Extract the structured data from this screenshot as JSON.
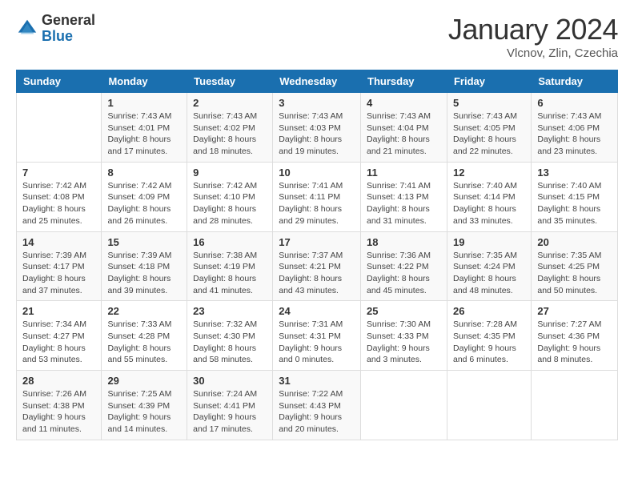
{
  "logo": {
    "general": "General",
    "blue": "Blue"
  },
  "title": "January 2024",
  "location": "Vlcnov, Zlin, Czechia",
  "days_header": [
    "Sunday",
    "Monday",
    "Tuesday",
    "Wednesday",
    "Thursday",
    "Friday",
    "Saturday"
  ],
  "weeks": [
    [
      {
        "num": "",
        "sunrise": "",
        "sunset": "",
        "daylight": ""
      },
      {
        "num": "1",
        "sunrise": "Sunrise: 7:43 AM",
        "sunset": "Sunset: 4:01 PM",
        "daylight": "Daylight: 8 hours and 17 minutes."
      },
      {
        "num": "2",
        "sunrise": "Sunrise: 7:43 AM",
        "sunset": "Sunset: 4:02 PM",
        "daylight": "Daylight: 8 hours and 18 minutes."
      },
      {
        "num": "3",
        "sunrise": "Sunrise: 7:43 AM",
        "sunset": "Sunset: 4:03 PM",
        "daylight": "Daylight: 8 hours and 19 minutes."
      },
      {
        "num": "4",
        "sunrise": "Sunrise: 7:43 AM",
        "sunset": "Sunset: 4:04 PM",
        "daylight": "Daylight: 8 hours and 21 minutes."
      },
      {
        "num": "5",
        "sunrise": "Sunrise: 7:43 AM",
        "sunset": "Sunset: 4:05 PM",
        "daylight": "Daylight: 8 hours and 22 minutes."
      },
      {
        "num": "6",
        "sunrise": "Sunrise: 7:43 AM",
        "sunset": "Sunset: 4:06 PM",
        "daylight": "Daylight: 8 hours and 23 minutes."
      }
    ],
    [
      {
        "num": "7",
        "sunrise": "Sunrise: 7:42 AM",
        "sunset": "Sunset: 4:08 PM",
        "daylight": "Daylight: 8 hours and 25 minutes."
      },
      {
        "num": "8",
        "sunrise": "Sunrise: 7:42 AM",
        "sunset": "Sunset: 4:09 PM",
        "daylight": "Daylight: 8 hours and 26 minutes."
      },
      {
        "num": "9",
        "sunrise": "Sunrise: 7:42 AM",
        "sunset": "Sunset: 4:10 PM",
        "daylight": "Daylight: 8 hours and 28 minutes."
      },
      {
        "num": "10",
        "sunrise": "Sunrise: 7:41 AM",
        "sunset": "Sunset: 4:11 PM",
        "daylight": "Daylight: 8 hours and 29 minutes."
      },
      {
        "num": "11",
        "sunrise": "Sunrise: 7:41 AM",
        "sunset": "Sunset: 4:13 PM",
        "daylight": "Daylight: 8 hours and 31 minutes."
      },
      {
        "num": "12",
        "sunrise": "Sunrise: 7:40 AM",
        "sunset": "Sunset: 4:14 PM",
        "daylight": "Daylight: 8 hours and 33 minutes."
      },
      {
        "num": "13",
        "sunrise": "Sunrise: 7:40 AM",
        "sunset": "Sunset: 4:15 PM",
        "daylight": "Daylight: 8 hours and 35 minutes."
      }
    ],
    [
      {
        "num": "14",
        "sunrise": "Sunrise: 7:39 AM",
        "sunset": "Sunset: 4:17 PM",
        "daylight": "Daylight: 8 hours and 37 minutes."
      },
      {
        "num": "15",
        "sunrise": "Sunrise: 7:39 AM",
        "sunset": "Sunset: 4:18 PM",
        "daylight": "Daylight: 8 hours and 39 minutes."
      },
      {
        "num": "16",
        "sunrise": "Sunrise: 7:38 AM",
        "sunset": "Sunset: 4:19 PM",
        "daylight": "Daylight: 8 hours and 41 minutes."
      },
      {
        "num": "17",
        "sunrise": "Sunrise: 7:37 AM",
        "sunset": "Sunset: 4:21 PM",
        "daylight": "Daylight: 8 hours and 43 minutes."
      },
      {
        "num": "18",
        "sunrise": "Sunrise: 7:36 AM",
        "sunset": "Sunset: 4:22 PM",
        "daylight": "Daylight: 8 hours and 45 minutes."
      },
      {
        "num": "19",
        "sunrise": "Sunrise: 7:35 AM",
        "sunset": "Sunset: 4:24 PM",
        "daylight": "Daylight: 8 hours and 48 minutes."
      },
      {
        "num": "20",
        "sunrise": "Sunrise: 7:35 AM",
        "sunset": "Sunset: 4:25 PM",
        "daylight": "Daylight: 8 hours and 50 minutes."
      }
    ],
    [
      {
        "num": "21",
        "sunrise": "Sunrise: 7:34 AM",
        "sunset": "Sunset: 4:27 PM",
        "daylight": "Daylight: 8 hours and 53 minutes."
      },
      {
        "num": "22",
        "sunrise": "Sunrise: 7:33 AM",
        "sunset": "Sunset: 4:28 PM",
        "daylight": "Daylight: 8 hours and 55 minutes."
      },
      {
        "num": "23",
        "sunrise": "Sunrise: 7:32 AM",
        "sunset": "Sunset: 4:30 PM",
        "daylight": "Daylight: 8 hours and 58 minutes."
      },
      {
        "num": "24",
        "sunrise": "Sunrise: 7:31 AM",
        "sunset": "Sunset: 4:31 PM",
        "daylight": "Daylight: 9 hours and 0 minutes."
      },
      {
        "num": "25",
        "sunrise": "Sunrise: 7:30 AM",
        "sunset": "Sunset: 4:33 PM",
        "daylight": "Daylight: 9 hours and 3 minutes."
      },
      {
        "num": "26",
        "sunrise": "Sunrise: 7:28 AM",
        "sunset": "Sunset: 4:35 PM",
        "daylight": "Daylight: 9 hours and 6 minutes."
      },
      {
        "num": "27",
        "sunrise": "Sunrise: 7:27 AM",
        "sunset": "Sunset: 4:36 PM",
        "daylight": "Daylight: 9 hours and 8 minutes."
      }
    ],
    [
      {
        "num": "28",
        "sunrise": "Sunrise: 7:26 AM",
        "sunset": "Sunset: 4:38 PM",
        "daylight": "Daylight: 9 hours and 11 minutes."
      },
      {
        "num": "29",
        "sunrise": "Sunrise: 7:25 AM",
        "sunset": "Sunset: 4:39 PM",
        "daylight": "Daylight: 9 hours and 14 minutes."
      },
      {
        "num": "30",
        "sunrise": "Sunrise: 7:24 AM",
        "sunset": "Sunset: 4:41 PM",
        "daylight": "Daylight: 9 hours and 17 minutes."
      },
      {
        "num": "31",
        "sunrise": "Sunrise: 7:22 AM",
        "sunset": "Sunset: 4:43 PM",
        "daylight": "Daylight: 9 hours and 20 minutes."
      },
      {
        "num": "",
        "sunrise": "",
        "sunset": "",
        "daylight": ""
      },
      {
        "num": "",
        "sunrise": "",
        "sunset": "",
        "daylight": ""
      },
      {
        "num": "",
        "sunrise": "",
        "sunset": "",
        "daylight": ""
      }
    ]
  ]
}
